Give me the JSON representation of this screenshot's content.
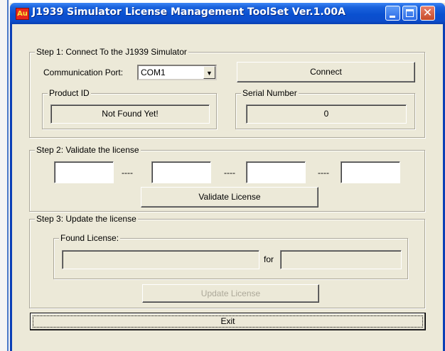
{
  "window": {
    "title": "J1939 Simulator License Management ToolSet Ver.1.00A",
    "icon_text": "Au"
  },
  "step1": {
    "title": "Step 1: Connect To the J1939 Simulator",
    "port_label": "Communication Port:",
    "port_value": "COM1",
    "connect_button": "Connect",
    "product_id_title": "Product ID",
    "product_id_value": "Not Found Yet!",
    "serial_title": "Serial Number",
    "serial_value": "0"
  },
  "step2": {
    "title": "Step 2: Validate the license",
    "license_fields": [
      "",
      "",
      "",
      ""
    ],
    "separator": "----",
    "validate_button": "Validate License"
  },
  "step3": {
    "title": "Step 3: Update the license",
    "found_license_title": "Found License:",
    "found_license_value": "",
    "for_label": "for",
    "for_value": "",
    "update_button": "Update License"
  },
  "exit_button": "Exit"
}
